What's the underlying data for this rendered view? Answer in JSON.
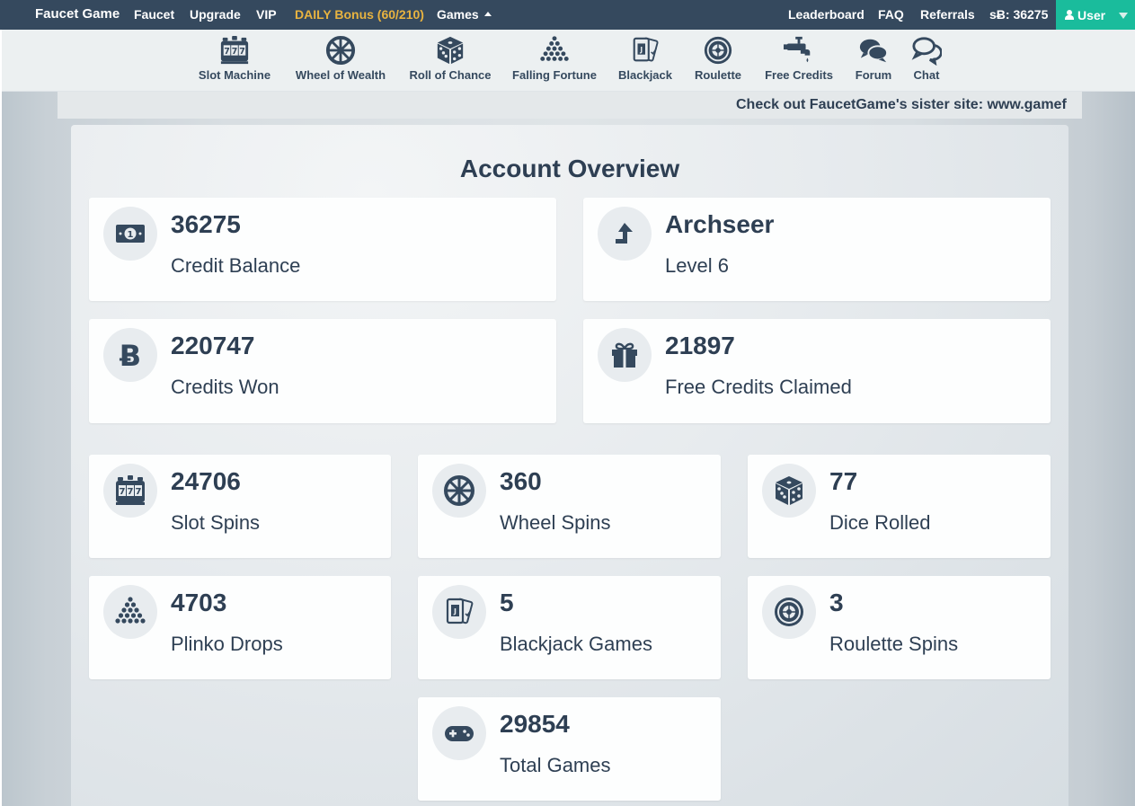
{
  "topbar": {
    "brand": "Faucet Game",
    "nav": [
      "Faucet",
      "Upgrade",
      "VIP",
      "DAILY Bonus (60/210)",
      "Games"
    ],
    "right": [
      "Leaderboard",
      "FAQ",
      "Referrals",
      "sɃ: 36275"
    ],
    "user": "User"
  },
  "games": [
    {
      "label": "Slot Machine",
      "icon": "slot-machine-icon"
    },
    {
      "label": "Wheel of Wealth",
      "icon": "wheel-icon"
    },
    {
      "label": "Roll of Chance",
      "icon": "dice-icon"
    },
    {
      "label": "Falling Fortune",
      "icon": "plinko-icon"
    },
    {
      "label": "Blackjack",
      "icon": "cards-icon"
    },
    {
      "label": "Roulette",
      "icon": "roulette-icon"
    },
    {
      "label": "Free Credits",
      "icon": "faucet-icon"
    },
    {
      "label": "Forum",
      "icon": "forum-icon"
    },
    {
      "label": "Chat",
      "icon": "chat-icon"
    }
  ],
  "ticker": "Check out FaucetGame's sister site: www.gamef",
  "overview": {
    "title": "Account Overview",
    "top": [
      {
        "value": "36275",
        "label": "Credit Balance",
        "icon": "banknote-icon"
      },
      {
        "value": "Archseer",
        "label": "Level 6",
        "icon": "level-up-icon"
      },
      {
        "value": "220747",
        "label": "Credits Won",
        "icon": "bitcoin-icon"
      },
      {
        "value": "21897",
        "label": "Free Credits Claimed",
        "icon": "gift-icon"
      }
    ],
    "stats": [
      {
        "value": "24706",
        "label": "Slot Spins",
        "icon": "slot-machine-icon"
      },
      {
        "value": "360",
        "label": "Wheel Spins",
        "icon": "wheel-icon"
      },
      {
        "value": "77",
        "label": "Dice Rolled",
        "icon": "dice-icon"
      },
      {
        "value": "4703",
        "label": "Plinko Drops",
        "icon": "plinko-icon"
      },
      {
        "value": "5",
        "label": "Blackjack Games",
        "icon": "cards-icon"
      },
      {
        "value": "3",
        "label": "Roulette Spins",
        "icon": "roulette-icon"
      },
      {
        "value": "29854",
        "label": "Total Games",
        "icon": "gamepad-icon"
      }
    ]
  },
  "colors": {
    "topbar": "#35495e",
    "accent": "#1abc9c",
    "bonus": "#e8b340",
    "text": "#2e3f53"
  }
}
